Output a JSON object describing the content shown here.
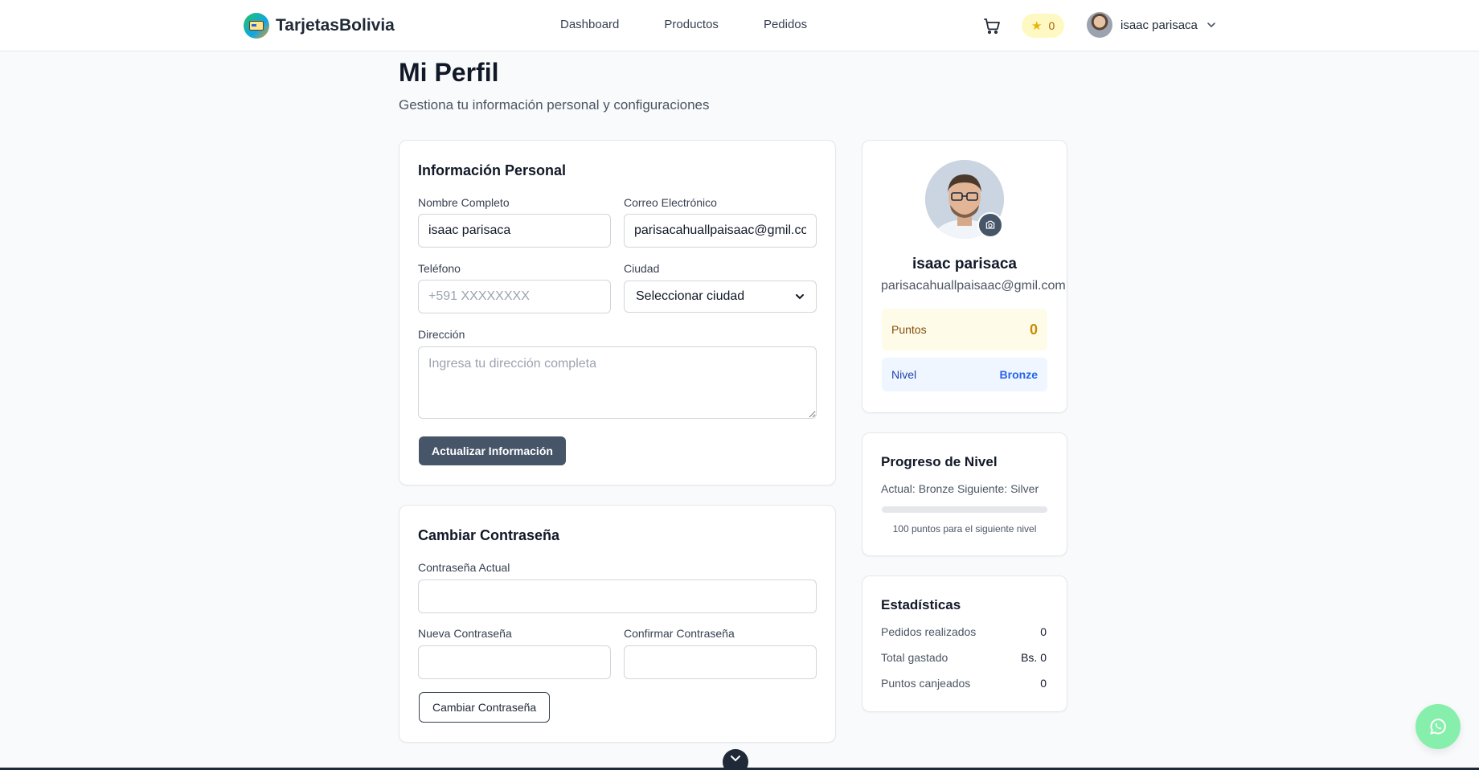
{
  "header": {
    "brand": "TarjetasBolivia",
    "nav": [
      "Dashboard",
      "Productos",
      "Pedidos"
    ],
    "points": "0",
    "user_name": "isaac parisaca"
  },
  "page": {
    "title": "Mi Perfil",
    "subtitle": "Gestiona tu información personal y configuraciones"
  },
  "personal_info": {
    "title": "Información Personal",
    "name_label": "Nombre Completo",
    "name_value": "isaac parisaca",
    "email_label": "Correo Electrónico",
    "email_value": "parisacahuallpaisaac@gmil.com",
    "phone_label": "Teléfono",
    "phone_placeholder": "+591 XXXXXXXX",
    "city_label": "Ciudad",
    "city_value": "Seleccionar ciudad",
    "address_label": "Dirección",
    "address_placeholder": "Ingresa tu dirección completa",
    "submit_label": "Actualizar Información"
  },
  "password": {
    "title": "Cambiar Contraseña",
    "current_label": "Contraseña Actual",
    "new_label": "Nueva Contraseña",
    "confirm_label": "Confirmar Contraseña",
    "submit_label": "Cambiar Contraseña"
  },
  "profile_card": {
    "name": "isaac parisaca",
    "email": "parisacahuallpaisaac@gmil.com",
    "points_label": "Puntos",
    "points_value": "0",
    "level_label": "Nivel",
    "level_value": "Bronze"
  },
  "level_progress": {
    "title": "Progreso de Nivel",
    "status_text": "Actual: Bronze Siguiente: Silver",
    "progress_fraction": 0,
    "note": "100 puntos para el siguiente nivel"
  },
  "stats": {
    "title": "Estadísticas",
    "rows": [
      {
        "label": "Pedidos realizados",
        "value": "0"
      },
      {
        "label": "Total gastado",
        "value": "Bs. 0"
      },
      {
        "label": "Puntos canjeados",
        "value": "0"
      }
    ]
  },
  "colors": {
    "primary_button": "#475569",
    "points_accent": "#ca8a04",
    "level_accent": "#2563eb",
    "whatsapp": "#86efac"
  }
}
